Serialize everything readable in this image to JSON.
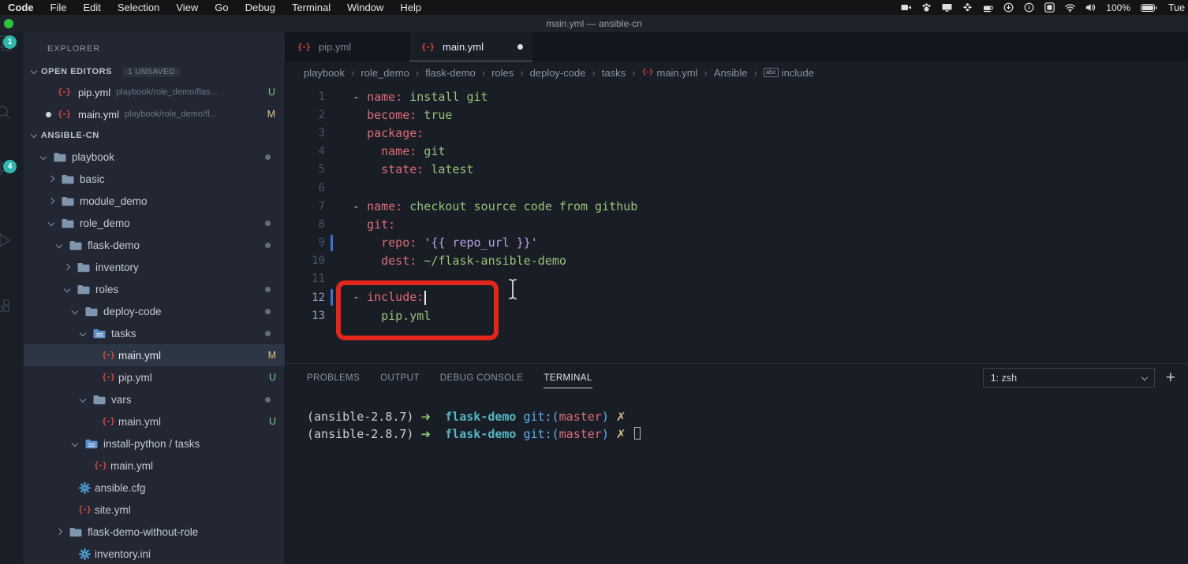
{
  "colors": {
    "annotation_red": "#e3261b",
    "badge_teal": "#2fb7ab",
    "git_modified_badge": "#e2c08d",
    "git_untracked_badge": "#73c991",
    "yaml_key": "#e06c75",
    "yaml_value": "#98c379",
    "yaml_jinja": "#bda2e8",
    "term_green": "#8fc46f",
    "term_cyan": "#56b6c2",
    "term_blue": "#61afef",
    "term_red": "#e06c75",
    "term_yellow": "#d7ba7d",
    "file_icon_red": "#d9473b",
    "gear_blue": "#4f9fd6",
    "folder_blue": "#8096ae"
  },
  "menubar": {
    "app": "Code",
    "items": [
      "File",
      "Edit",
      "Selection",
      "View",
      "Go",
      "Debug",
      "Terminal",
      "Window",
      "Help"
    ],
    "status_icons": [
      "camera-icon",
      "paw-icon",
      "display-icon",
      "dropbox-icon",
      "coffee-icon",
      "download-icon",
      "info-icon",
      "input-source-icon",
      "wifi-icon",
      "volume-icon"
    ],
    "battery": "100%",
    "day": "Tue"
  },
  "titlebar": {
    "title": "main.yml — ansible-cn"
  },
  "activity_bar": {
    "items": [
      {
        "icon": "explorer-icon",
        "badge": "1"
      },
      {
        "icon": "search-icon"
      },
      {
        "icon": "source-control-icon",
        "badge": "4"
      },
      {
        "icon": "debug-icon"
      },
      {
        "icon": "extensions-icon"
      }
    ]
  },
  "sidebar": {
    "title": "EXPLORER",
    "open_editors": {
      "label": "OPEN EDITORS",
      "badge": "1 UNSAVED",
      "items": [
        {
          "name": "pip.yml",
          "path": "playbook/role_demo/flas...",
          "status": "U",
          "dirty": false
        },
        {
          "name": "main.yml",
          "path": "playbook/role_demo/fl...",
          "status": "M",
          "dirty": true
        }
      ]
    },
    "project": {
      "label": "ANSIBLE-CN",
      "tree": [
        {
          "label": "playbook",
          "level": 0,
          "kind": "folder",
          "expanded": true,
          "dot": true
        },
        {
          "label": "basic",
          "level": 1,
          "kind": "folder",
          "expanded": false
        },
        {
          "label": "module_demo",
          "level": 1,
          "kind": "folder",
          "expanded": false
        },
        {
          "label": "role_demo",
          "level": 1,
          "kind": "folder",
          "expanded": true,
          "dot": true
        },
        {
          "label": "flask-demo",
          "level": 2,
          "kind": "folder",
          "expanded": true,
          "dot": true
        },
        {
          "label": "inventory",
          "level": 3,
          "kind": "folder",
          "expanded": false
        },
        {
          "label": "roles",
          "level": 3,
          "kind": "folder",
          "expanded": true,
          "dot": true
        },
        {
          "label": "deploy-code",
          "level": 4,
          "kind": "folder",
          "expanded": true,
          "dot": true
        },
        {
          "label": "tasks",
          "level": 5,
          "kind": "folder",
          "expanded": true,
          "dot": true,
          "icon": "tasks-folder"
        },
        {
          "label": "main.yml",
          "level": 6,
          "kind": "file",
          "icon": "yaml",
          "badge": "M",
          "selected": true
        },
        {
          "label": "pip.yml",
          "level": 6,
          "kind": "file",
          "icon": "yaml",
          "badge": "U"
        },
        {
          "label": "vars",
          "level": 5,
          "kind": "folder",
          "expanded": true,
          "dot": true
        },
        {
          "label": "main.yml",
          "level": 6,
          "kind": "file",
          "icon": "yaml",
          "badge": "U"
        },
        {
          "label": "install-python / tasks",
          "level": 4,
          "kind": "folder",
          "expanded": true,
          "icon": "tasks-folder"
        },
        {
          "label": "main.yml",
          "level": 5,
          "kind": "file",
          "icon": "yaml"
        },
        {
          "label": "ansible.cfg",
          "level": 3,
          "kind": "file",
          "icon": "gear"
        },
        {
          "label": "site.yml",
          "level": 3,
          "kind": "file",
          "icon": "yaml"
        },
        {
          "label": "flask-demo-without-role",
          "level": 2,
          "kind": "folder",
          "expanded": false
        },
        {
          "label": "inventory.ini",
          "level": 3,
          "kind": "file",
          "icon": "gear"
        }
      ]
    }
  },
  "editor": {
    "tabs": [
      {
        "name": "pip.yml",
        "dirty": false,
        "active": false
      },
      {
        "name": "main.yml",
        "dirty": true,
        "active": true
      }
    ],
    "breadcrumb": [
      {
        "label": "playbook"
      },
      {
        "label": "role_demo"
      },
      {
        "label": "flask-demo"
      },
      {
        "label": "roles"
      },
      {
        "label": "deploy-code"
      },
      {
        "label": "tasks"
      },
      {
        "label": "main.yml",
        "icon": "yaml"
      },
      {
        "label": "Ansible"
      },
      {
        "label": "include",
        "icon": "abc"
      }
    ],
    "symbol_icon_label": "abc",
    "lines": [
      {
        "n": 1,
        "tokens": [
          [
            "pu",
            "- "
          ],
          [
            "key",
            "name:"
          ],
          [
            "val",
            " install git"
          ]
        ]
      },
      {
        "n": 2,
        "tokens": [
          [
            "pu",
            "  "
          ],
          [
            "key",
            "become:"
          ],
          [
            "val",
            " true"
          ]
        ]
      },
      {
        "n": 3,
        "tokens": [
          [
            "pu",
            "  "
          ],
          [
            "key",
            "package:"
          ]
        ]
      },
      {
        "n": 4,
        "tokens": [
          [
            "pu",
            "    "
          ],
          [
            "key",
            "name:"
          ],
          [
            "val",
            " git"
          ]
        ]
      },
      {
        "n": 5,
        "tokens": [
          [
            "pu",
            "    "
          ],
          [
            "key",
            "state:"
          ],
          [
            "val",
            " latest"
          ]
        ]
      },
      {
        "n": 6,
        "tokens": []
      },
      {
        "n": 7,
        "tokens": [
          [
            "pu",
            "- "
          ],
          [
            "key",
            "name:"
          ],
          [
            "val",
            " checkout source code from github"
          ]
        ]
      },
      {
        "n": 8,
        "tokens": [
          [
            "pu",
            "  "
          ],
          [
            "key",
            "git:"
          ]
        ]
      },
      {
        "n": 9,
        "tokens": [
          [
            "pu",
            "    "
          ],
          [
            "key",
            "repo:"
          ],
          [
            "jinja",
            " '{{ repo_url }}'"
          ]
        ],
        "marker": true
      },
      {
        "n": 10,
        "tokens": [
          [
            "pu",
            "    "
          ],
          [
            "key",
            "dest:"
          ],
          [
            "val",
            " ~/flask-ansible-demo"
          ]
        ]
      },
      {
        "n": 11,
        "tokens": []
      },
      {
        "n": 12,
        "tokens": [
          [
            "pu",
            "- "
          ],
          [
            "key",
            "include:"
          ]
        ],
        "marker": true,
        "caret": true,
        "active": true
      },
      {
        "n": 13,
        "tokens": [
          [
            "pu",
            "    "
          ],
          [
            "val",
            "pip.yml"
          ]
        ],
        "active": true
      }
    ]
  },
  "panel": {
    "tabs": [
      {
        "label": "PROBLEMS",
        "active": false
      },
      {
        "label": "OUTPUT",
        "active": false
      },
      {
        "label": "DEBUG CONSOLE",
        "active": false
      },
      {
        "label": "TERMINAL",
        "active": true
      }
    ],
    "shell_select": "1: zsh",
    "terminal_lines": [
      {
        "tokens": [
          [
            "w",
            "(ansible-2.8.7) "
          ],
          [
            "g",
            "➜"
          ],
          [
            "w",
            "  "
          ],
          [
            "c",
            "flask-demo"
          ],
          [
            "w",
            " "
          ],
          [
            "b",
            "git:("
          ],
          [
            "r",
            "master"
          ],
          [
            "b",
            ")"
          ],
          [
            "w",
            " "
          ],
          [
            "y",
            "✗"
          ]
        ],
        "cursor": false
      },
      {
        "tokens": [
          [
            "w",
            "(ansible-2.8.7) "
          ],
          [
            "g",
            "➜"
          ],
          [
            "w",
            "  "
          ],
          [
            "c",
            "flask-demo"
          ],
          [
            "w",
            " "
          ],
          [
            "b",
            "git:("
          ],
          [
            "r",
            "master"
          ],
          [
            "b",
            ")"
          ],
          [
            "w",
            " "
          ],
          [
            "y",
            "✗"
          ],
          [
            "w",
            " "
          ]
        ],
        "cursor": true
      }
    ]
  }
}
